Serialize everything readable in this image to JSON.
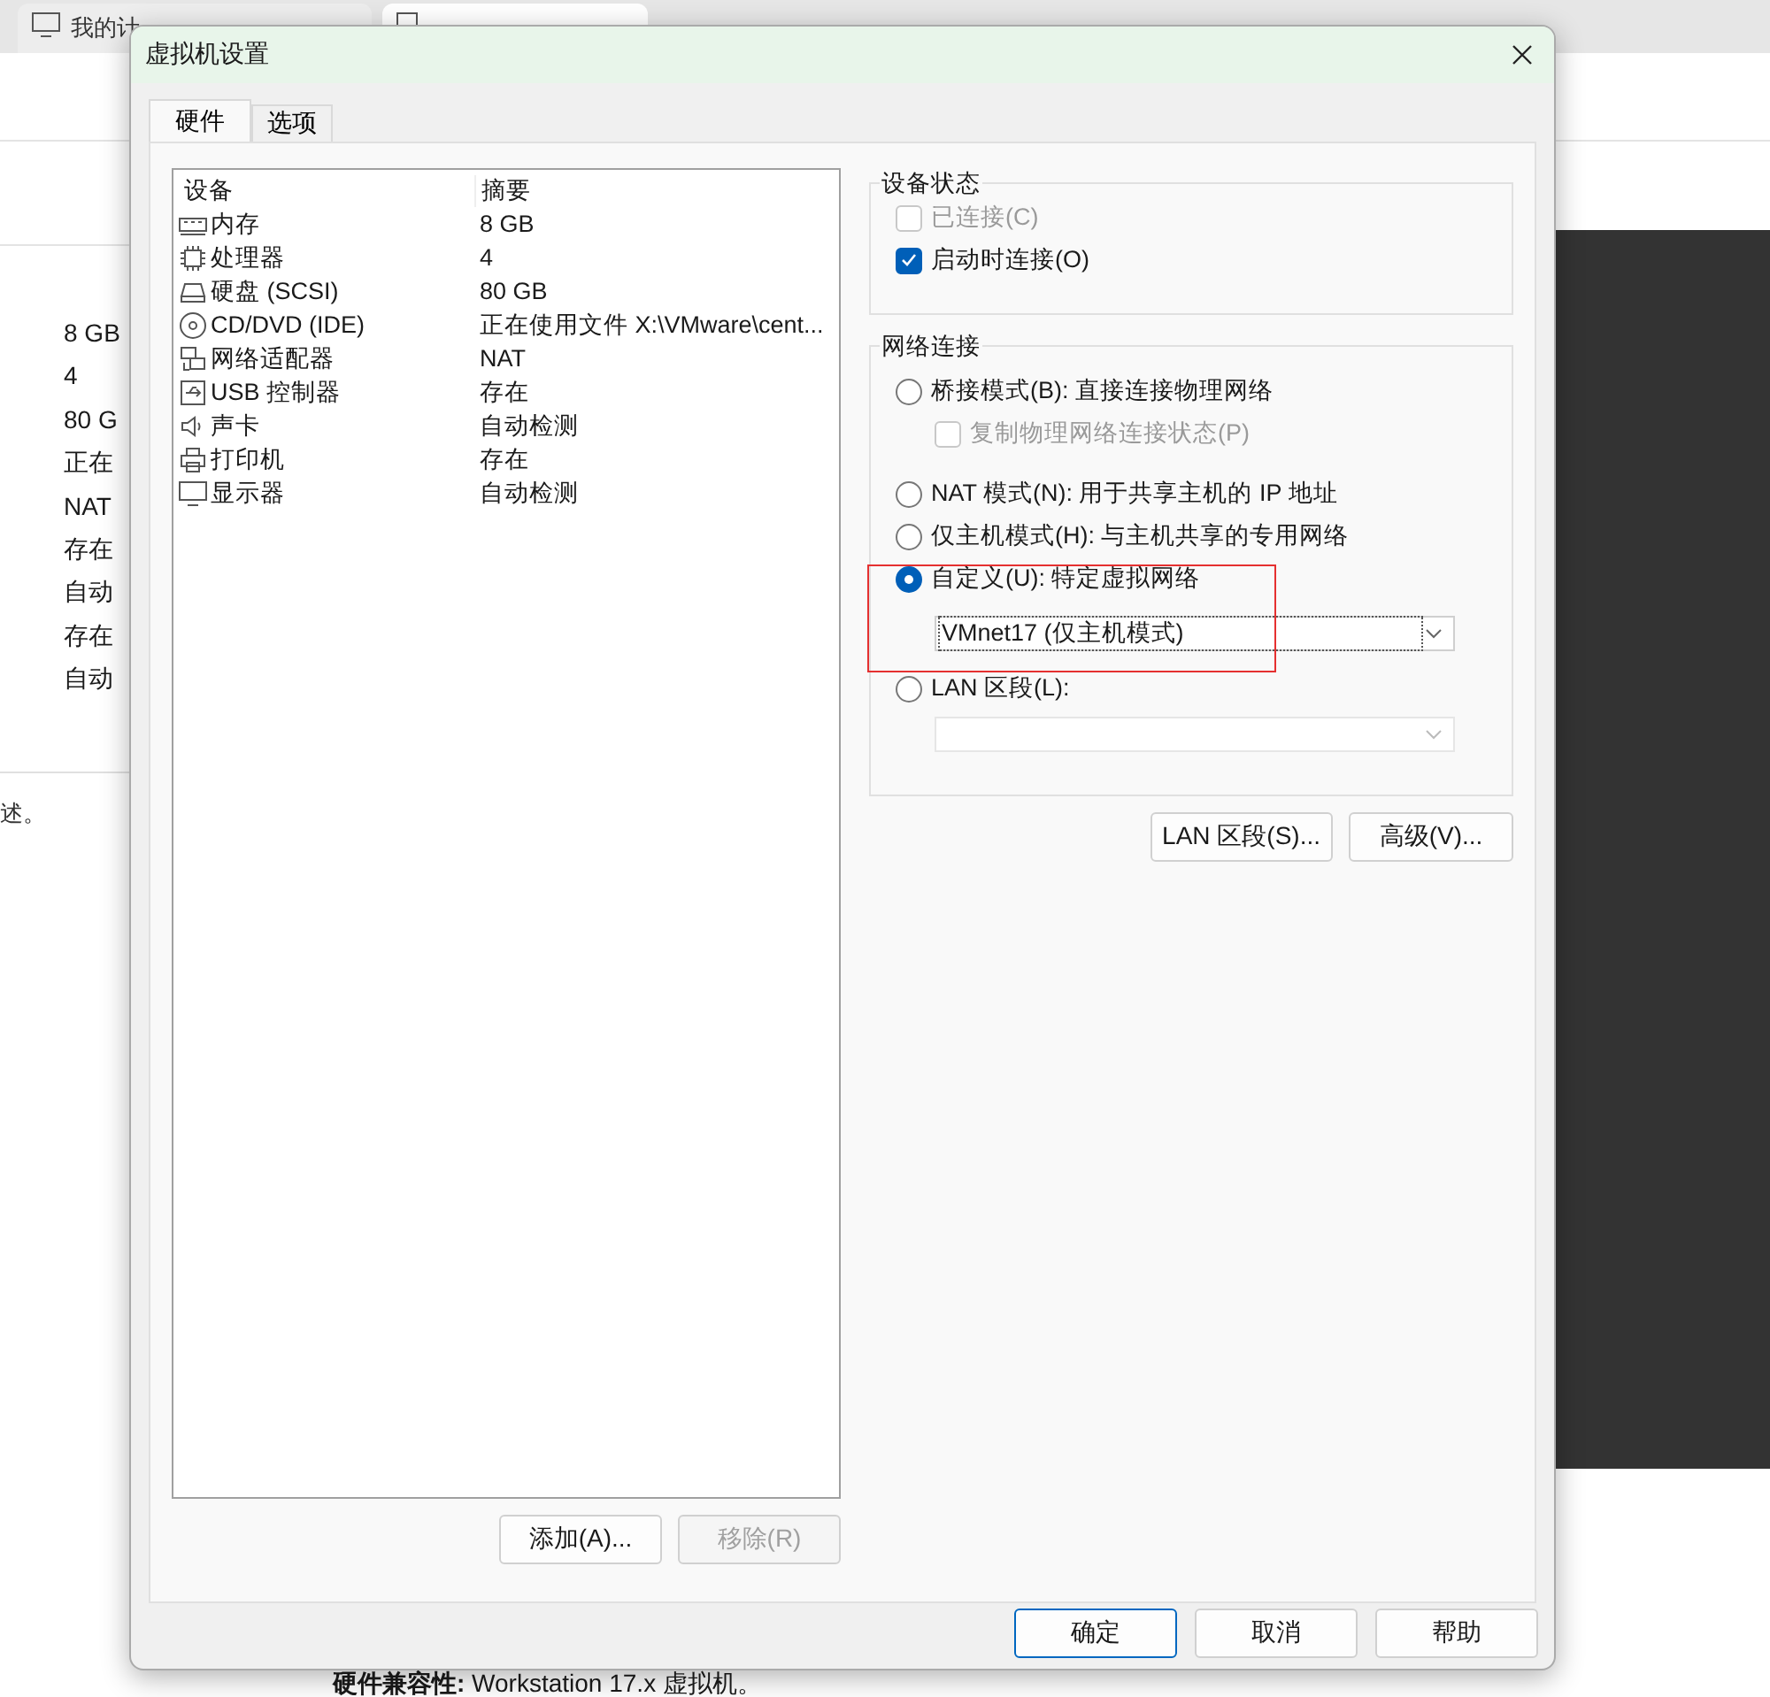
{
  "background": {
    "tab_label": "我的计",
    "summary_values": [
      "8 GB",
      "4",
      "80 G",
      "正在",
      "NAT",
      "存在",
      "自动",
      "存在",
      "自动"
    ],
    "description": "述。",
    "compatibility": "**硬件兼容性:** Workstation 17.x 虚拟机。"
  },
  "dialog": {
    "title": "虚拟机设置",
    "tabs": [
      {
        "label": "硬件",
        "selected": true
      },
      {
        "label": "选项",
        "selected": false
      }
    ],
    "device_table": {
      "columns": [
        "设备",
        "摘要"
      ],
      "rows": [
        {
          "kind": "memory",
          "device": "内存",
          "summary": "8 GB"
        },
        {
          "kind": "cpu",
          "device": "处理器",
          "summary": "4"
        },
        {
          "kind": "disk",
          "device": "硬盘 (SCSI)",
          "summary": "80 GB"
        },
        {
          "kind": "cd",
          "device": "CD/DVD (IDE)",
          "summary": "正在使用文件 X:\\VMware\\cent..."
        },
        {
          "kind": "network",
          "device": "网络适配器",
          "summary": "NAT"
        },
        {
          "kind": "usb",
          "device": "USB 控制器",
          "summary": "存在"
        },
        {
          "kind": "sound",
          "device": "声卡",
          "summary": "自动检测"
        },
        {
          "kind": "printer",
          "device": "打印机",
          "summary": "存在"
        },
        {
          "kind": "display",
          "device": "显示器",
          "summary": "自动检测"
        }
      ]
    },
    "list_buttons": [
      {
        "label": "添加(A)...",
        "disabled": false
      },
      {
        "label": "移除(R)",
        "disabled": true
      }
    ],
    "device_status": {
      "title": "设备状态",
      "options": [
        {
          "label": "已连接(C)",
          "checked": false,
          "disabled": true
        },
        {
          "label": "启动时连接(O)",
          "checked": true,
          "disabled": false
        }
      ]
    },
    "network": {
      "title": "网络连接",
      "options": [
        {
          "kind": "radio",
          "label": "桥接模式(B): 直接连接物理网络",
          "selected": false
        },
        {
          "kind": "checkbox",
          "label": "复制物理网络连接状态(P)",
          "checked": false,
          "disabled": true
        },
        {
          "kind": "radio",
          "label": "NAT 模式(N): 用于共享主机的 IP 地址",
          "selected": false
        },
        {
          "kind": "radio",
          "label": "仅主机模式(H): 与主机共享的专用网络",
          "selected": false
        },
        {
          "kind": "radio",
          "label": "自定义(U): 特定虚拟网络",
          "selected": true
        },
        {
          "kind": "select",
          "value": "VMnet17 (仅主机模式)",
          "disabled": false
        },
        {
          "kind": "radio",
          "label": "LAN 区段(L):",
          "selected": false
        },
        {
          "kind": "select",
          "disabled": true
        }
      ]
    },
    "side_buttons": [
      "LAN 区段(S)...",
      "高级(V)..."
    ],
    "footer_buttons": [
      {
        "label": "确定",
        "default": true
      },
      {
        "label": "取消",
        "default": false
      },
      {
        "label": "帮助",
        "default": false
      }
    ]
  }
}
